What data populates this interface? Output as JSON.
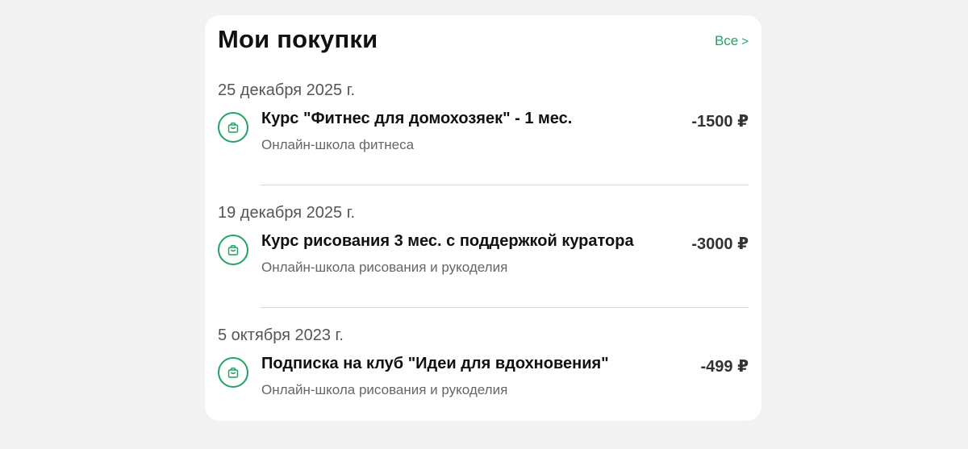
{
  "header": {
    "title": "Мои покупки",
    "all_link": "Все",
    "all_link_icon": "chevron-right-icon"
  },
  "colors": {
    "accent": "#21a366",
    "background": "#f2f2f2",
    "card": "#ffffff"
  },
  "purchases": [
    {
      "date": "25 декабря 2025 г.",
      "icon": "shopping-bag-icon",
      "name": "Курс \"Фитнес для домохозяек\" - 1 мес.",
      "merchant": "Онлайн-школа фитнеса",
      "amount": "-1500 ₽"
    },
    {
      "date": "19 декабря 2025 г.",
      "icon": "shopping-bag-icon",
      "name": "Курс рисования 3 мес. с поддержкой куратора",
      "merchant": "Онлайн-школа рисования и рукоделия",
      "amount": "-3000 ₽"
    },
    {
      "date": "5 октября 2023 г.",
      "icon": "shopping-bag-icon",
      "name": "Подписка на клуб \"Идеи для вдохновения\"",
      "merchant": "Онлайн-школа рисования и рукоделия",
      "amount": "-499 ₽"
    }
  ]
}
